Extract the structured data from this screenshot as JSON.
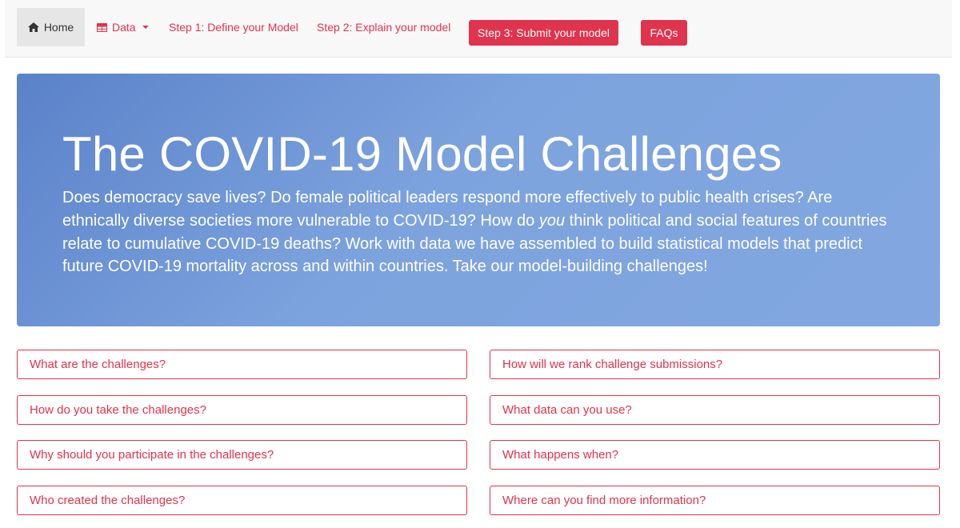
{
  "nav": {
    "home_icon": "home-icon",
    "home_label": "Home",
    "data_icon": "table-icon",
    "data_label": "Data",
    "step1_label": "Step 1: Define your Model",
    "step2_label": "Step 2: Explain your model",
    "step3_label": "Step 3: Submit your model",
    "faqs_label": "FAQs"
  },
  "hero": {
    "title": "The COVID-19 Model Challenges",
    "text_part1": "Does democracy save lives? Do female political leaders respond more effectively to public health crises? Are ethnically diverse societies more vulnerable to COVID-19? How do ",
    "text_emphasis": "you",
    "text_part2": " think political and social features of countries relate to cumulative COVID-19 deaths? Work with data we have assembled to build statistical models that predict future COVID-19 mortality across and within countries. Take our model-building challenges!"
  },
  "faq": {
    "left": [
      "What are the challenges?",
      "How do you take the challenges?",
      "Why should you participate in the challenges?",
      "Who created the challenges?"
    ],
    "right": [
      "How will we rank challenge submissions?",
      "What data can you use?",
      "What happens when?",
      "Where can you find more information?"
    ]
  },
  "colors": {
    "accent": "#e0334e",
    "hero_start": "#5a82c9",
    "hero_end": "#82a7e0",
    "navbar_bg": "#f8f8f8",
    "home_active_bg": "#e6e6e6"
  }
}
